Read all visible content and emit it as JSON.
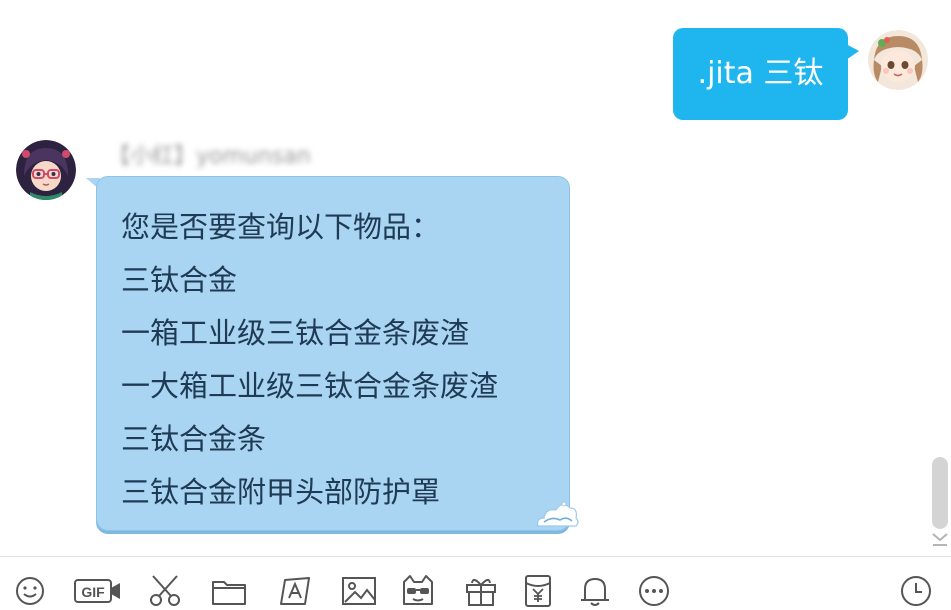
{
  "conversation": {
    "outgoing": {
      "text": ".jita 三钛"
    },
    "incoming": {
      "sender": "【小红】yomunsan",
      "lines": [
        "您是否要查询以下物品：",
        "三钛合金",
        "一箱工业级三钛合金条废渣",
        "一大箱工业级三钛合金条废渣",
        "三钛合金条",
        "三钛合金附甲头部防护罩"
      ]
    }
  },
  "toolbar": {
    "items": [
      {
        "icon": "emoji-icon"
      },
      {
        "icon": "gif-icon",
        "label": "GIF"
      },
      {
        "icon": "scissors-icon"
      },
      {
        "icon": "folder-icon"
      },
      {
        "icon": "doodle-icon"
      },
      {
        "icon": "image-icon"
      },
      {
        "icon": "game-icon"
      },
      {
        "icon": "gift-icon"
      },
      {
        "icon": "red-packet-icon"
      },
      {
        "icon": "bell-icon"
      },
      {
        "icon": "more-icon"
      },
      {
        "icon": "history-icon"
      }
    ]
  },
  "colors": {
    "outgoing_bubble": "#1fb6f0",
    "incoming_bubble": "#a9d5f2",
    "incoming_text": "#1f3a55",
    "icon_stroke": "#555555"
  }
}
